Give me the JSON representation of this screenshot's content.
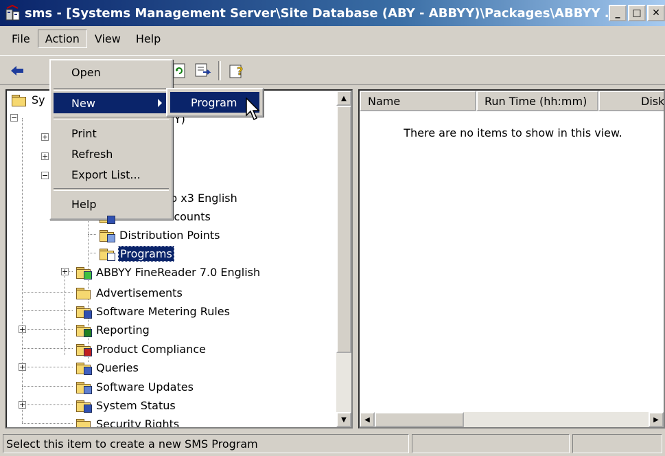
{
  "window": {
    "title": "sms - [Systems Management Server\\Site Database (ABY - ABBYY)\\Packages\\ABBYY ...",
    "minimize_label": "_",
    "maximize_label": "□",
    "close_label": "✕"
  },
  "menubar": {
    "file": "File",
    "action": "Action",
    "view": "View",
    "help": "Help"
  },
  "action_menu": {
    "items": [
      {
        "label": "Open"
      },
      {
        "label": "New"
      },
      {
        "label": "Print"
      },
      {
        "label": "Refresh"
      },
      {
        "label": "Export List..."
      },
      {
        "label": "Help"
      }
    ]
  },
  "new_submenu": {
    "items": [
      {
        "label": "Program"
      }
    ]
  },
  "tree": {
    "items": [
      {
        "label": "Sy"
      },
      {
        "label": "ABBYY)"
      },
      {
        "label": "p x3 English"
      },
      {
        "label": "Access Accounts"
      },
      {
        "label": "Distribution Points"
      },
      {
        "label": "Programs"
      },
      {
        "label": "ABBYY FineReader 7.0 English"
      },
      {
        "label": "Advertisements"
      },
      {
        "label": "Software Metering Rules"
      },
      {
        "label": "Reporting"
      },
      {
        "label": "Product Compliance"
      },
      {
        "label": "Queries"
      },
      {
        "label": "Software Updates"
      },
      {
        "label": "System Status"
      },
      {
        "label": "Security Rights"
      }
    ]
  },
  "list": {
    "columns": [
      {
        "label": "Name"
      },
      {
        "label": "Run Time (hh:mm)"
      },
      {
        "label": "Disk"
      }
    ],
    "empty_message": "There are no items to show in this view."
  },
  "statusbar": {
    "text": "Select this item to create a new SMS Program",
    "panel2": "",
    "panel3": ""
  },
  "colors": {
    "selection": "#0a246a",
    "face": "#d4d0c8",
    "folder": "#f6d870"
  }
}
